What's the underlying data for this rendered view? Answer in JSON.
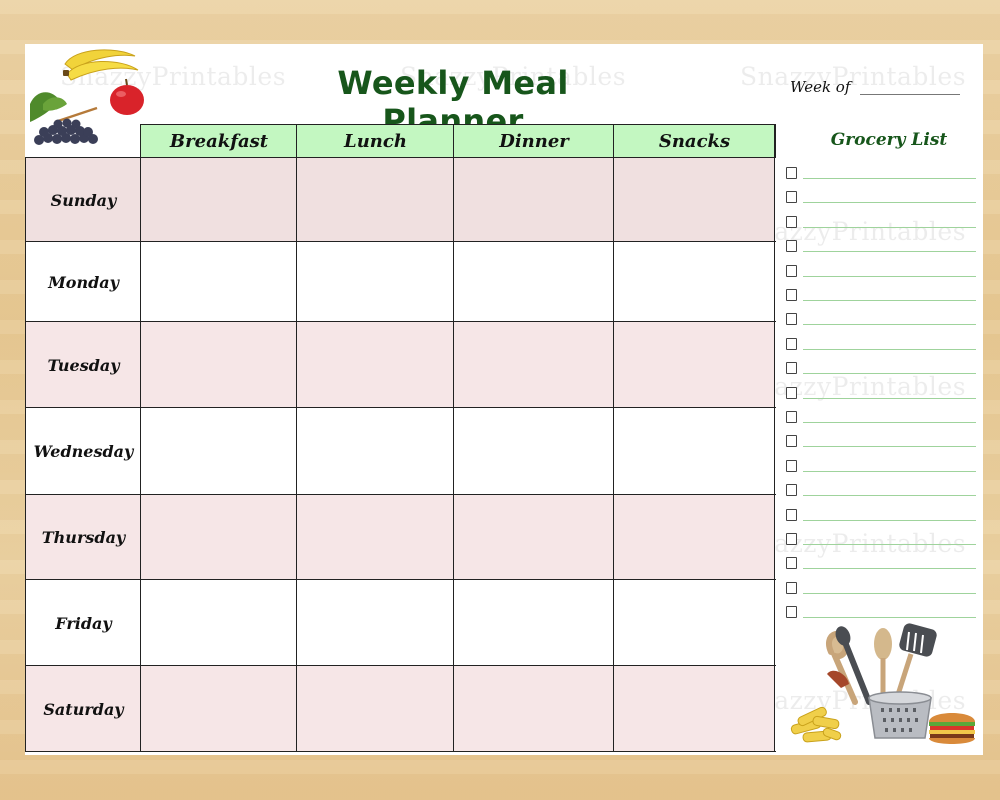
{
  "header": {
    "title": "Weekly Meal Planner",
    "week_of_label": "Week of",
    "week_of_value": ""
  },
  "watermark": "SnazzyPrintables",
  "table": {
    "columns": [
      "Breakfast",
      "Lunch",
      "Dinner",
      "Snacks"
    ],
    "days": [
      "Sunday",
      "Monday",
      "Tuesday",
      "Wednesday",
      "Thursday",
      "Friday",
      "Saturday"
    ],
    "meals": {
      "Sunday": [
        "",
        "",
        "",
        ""
      ],
      "Monday": [
        "",
        "",
        "",
        ""
      ],
      "Tuesday": [
        "",
        "",
        "",
        ""
      ],
      "Wednesday": [
        "",
        "",
        "",
        ""
      ],
      "Thursday": [
        "",
        "",
        "",
        ""
      ],
      "Friday": [
        "",
        "",
        "",
        ""
      ],
      "Saturday": [
        "",
        "",
        "",
        ""
      ]
    }
  },
  "grocery": {
    "title": "Grocery List",
    "item_count": 19,
    "items": [
      "",
      "",
      "",
      "",
      "",
      "",
      "",
      "",
      "",
      "",
      "",
      "",
      "",
      "",
      "",
      "",
      "",
      "",
      ""
    ]
  },
  "illustrations": {
    "top_left": [
      "banana-icon",
      "apple-icon",
      "grapes-icon"
    ],
    "bottom_right": [
      "utensil-holder-icon",
      "pasta-icon",
      "burger-icon"
    ]
  },
  "colors": {
    "title_green": "#17561b",
    "header_green": "#c3f7c1",
    "row_pink": "#f0e0e0",
    "grocery_line": "#9fd39c",
    "wood": "#e7c994"
  }
}
